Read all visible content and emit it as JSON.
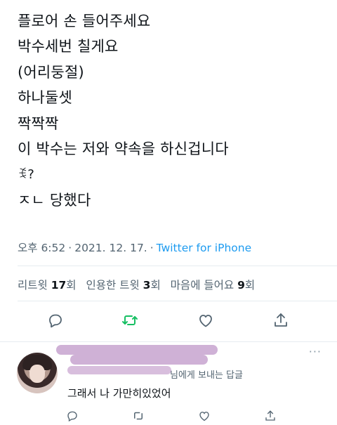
{
  "tweet": {
    "lines": [
      "플로어 손 들어주세요",
      "박수세번 칠게요",
      "(어리둥절)",
      "하나둘셋",
      "짝짝짝",
      "이 박수는 저와 약속을 하신겁니다",
      "ꉂ?",
      "ㅈㄴ 당했다"
    ],
    "time": "오후 6:52",
    "separator": "·",
    "date": "2021. 12. 17.",
    "source": "Twitter for iPhone"
  },
  "stats": {
    "retweets": {
      "label": "리트윗",
      "count": "17",
      "unit": "회"
    },
    "quotes": {
      "label": "인용한 트윗",
      "count": "3",
      "unit": "회"
    },
    "likes": {
      "label": "마음에 들어요",
      "count": "9",
      "unit": "회"
    }
  },
  "actions": {
    "icons": [
      "reply-icon",
      "retweet-icon",
      "like-icon",
      "share-icon"
    ],
    "retweet_color": "#17bf63",
    "icon_color": "#536471"
  },
  "reply": {
    "replying_to_suffix": "님에게 보내는 답글",
    "text": "그래서 나 가만히있었어",
    "more": "···",
    "redaction_color": "#c7a3cf"
  }
}
